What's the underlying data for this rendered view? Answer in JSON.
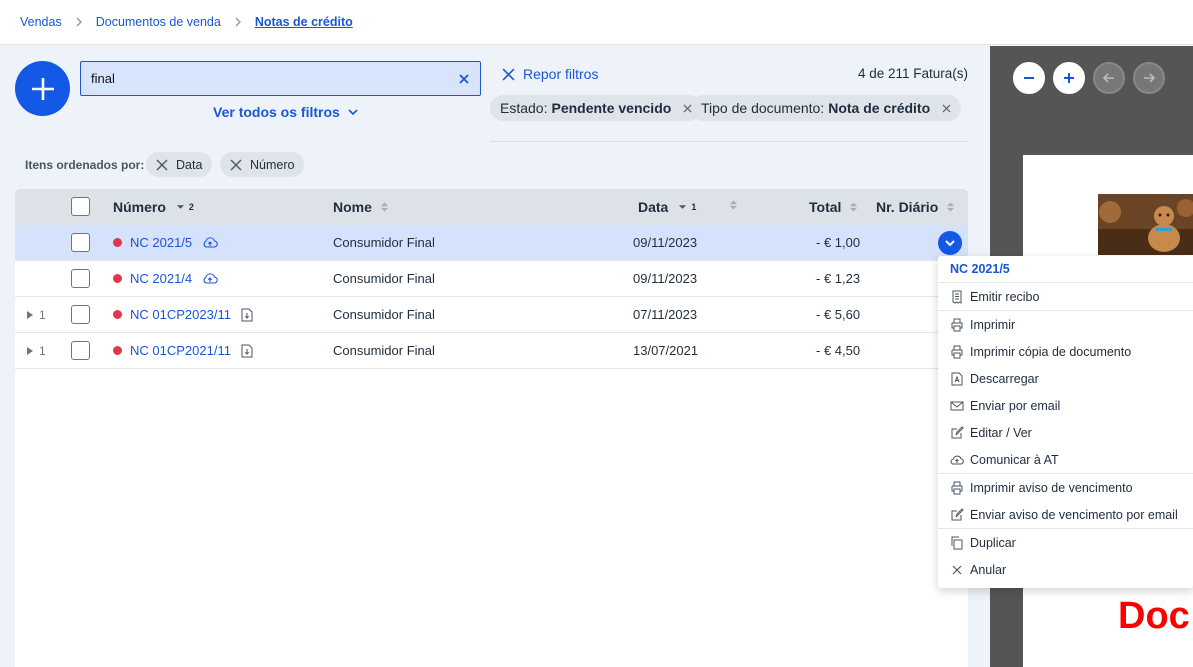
{
  "breadcrumb": [
    "Vendas",
    "Documentos de venda",
    "Notas de crédito"
  ],
  "search": {
    "value": "final"
  },
  "filters": {
    "all_filters_label": "Ver todos os filtros",
    "reset_label": "Repor filtros",
    "count": "4 de 211 Fatura(s)",
    "chips": [
      {
        "key": "Estado:",
        "value": "Pendente vencido"
      },
      {
        "key": "Tipo de documento:",
        "value": "Nota de crédito"
      }
    ]
  },
  "sort": {
    "label": "Itens ordenados por:",
    "chips": [
      "Data",
      "Número"
    ]
  },
  "table": {
    "columns": {
      "numero": "Número",
      "numero_order": "2",
      "nome": "Nome",
      "data": "Data",
      "data_order": "1",
      "total": "Total",
      "diario": "Nr. Diário"
    },
    "rows": [
      {
        "numero": "NC 2021/5",
        "nome": "Consumidor Final",
        "data": "09/11/2023",
        "total": "- € 1,00",
        "icon": "cloud-upload-icon",
        "expand": ""
      },
      {
        "numero": "NC 2021/4",
        "nome": "Consumidor Final",
        "data": "09/11/2023",
        "total": "- € 1,23",
        "icon": "cloud-upload-icon",
        "expand": ""
      },
      {
        "numero": "NC 01CP2023/11",
        "nome": "Consumidor Final",
        "data": "07/11/2023",
        "total": "- € 5,60",
        "icon": "document-icon",
        "expand": "1"
      },
      {
        "numero": "NC 01CP2021/11",
        "nome": "Consumidor Final",
        "data": "13/07/2021",
        "total": "- € 4,50",
        "icon": "document-icon",
        "expand": "1"
      }
    ]
  },
  "context_menu": {
    "title": "NC 2021/5",
    "items": [
      "Emitir recibo",
      "Imprimir",
      "Imprimir cópia de documento",
      "Descarregar",
      "Enviar por email",
      "Editar / Ver",
      "Comunicar à AT",
      "Imprimir aviso de vencimento",
      "Enviar aviso de vencimento por email",
      "Duplicar",
      "Anular"
    ]
  },
  "preview": {
    "doc_text": "Doc"
  },
  "colors": {
    "accent": "#1458e6",
    "link": "#1a56d6",
    "status_dot": "#e0374e",
    "selected_row": "#d6e2fb"
  }
}
